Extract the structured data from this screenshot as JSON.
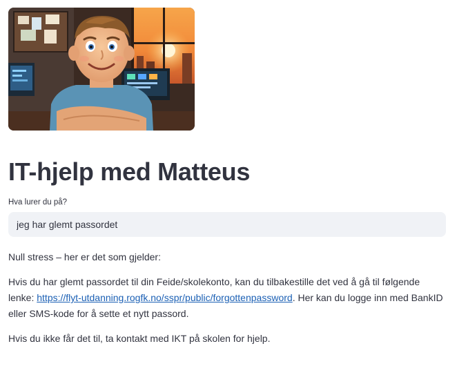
{
  "header": {
    "title": "IT-hjelp med Matteus"
  },
  "question": {
    "label": "Hva lurer du på?",
    "value": "jeg har glemt passordet"
  },
  "answer": {
    "intro": "Null stress – her er det som gjelder:",
    "para1_before_link": "Hvis du har glemt passordet til din Feide/skolekonto, kan du tilbakestille det ved å gå til følgende lenke: ",
    "link_text": "https://flyt-utdanning.rogfk.no/sspr/public/forgottenpassword",
    "para1_after_link": ". Her kan du logge inn med BankID eller SMS-kode for å sette et nytt passord.",
    "para2": "Hvis du ikke får det til, ta kontakt med IKT på skolen for hjelp."
  },
  "colors": {
    "text": "#31333f",
    "input_bg": "#f0f2f6",
    "link": "#1a5fb4"
  }
}
